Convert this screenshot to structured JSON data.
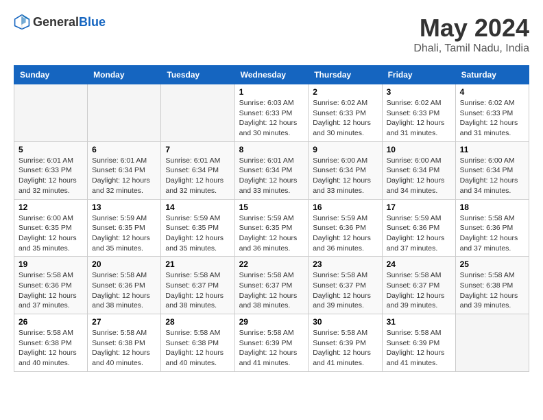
{
  "header": {
    "logo": {
      "general": "General",
      "blue": "Blue"
    },
    "month": "May 2024",
    "location": "Dhali, Tamil Nadu, India"
  },
  "weekdays": [
    "Sunday",
    "Monday",
    "Tuesday",
    "Wednesday",
    "Thursday",
    "Friday",
    "Saturday"
  ],
  "weeks": [
    [
      {
        "day": "",
        "sunrise": "",
        "sunset": "",
        "daylight": ""
      },
      {
        "day": "",
        "sunrise": "",
        "sunset": "",
        "daylight": ""
      },
      {
        "day": "",
        "sunrise": "",
        "sunset": "",
        "daylight": ""
      },
      {
        "day": "1",
        "sunrise": "Sunrise: 6:03 AM",
        "sunset": "Sunset: 6:33 PM",
        "daylight": "Daylight: 12 hours and 30 minutes."
      },
      {
        "day": "2",
        "sunrise": "Sunrise: 6:02 AM",
        "sunset": "Sunset: 6:33 PM",
        "daylight": "Daylight: 12 hours and 30 minutes."
      },
      {
        "day": "3",
        "sunrise": "Sunrise: 6:02 AM",
        "sunset": "Sunset: 6:33 PM",
        "daylight": "Daylight: 12 hours and 31 minutes."
      },
      {
        "day": "4",
        "sunrise": "Sunrise: 6:02 AM",
        "sunset": "Sunset: 6:33 PM",
        "daylight": "Daylight: 12 hours and 31 minutes."
      }
    ],
    [
      {
        "day": "5",
        "sunrise": "Sunrise: 6:01 AM",
        "sunset": "Sunset: 6:33 PM",
        "daylight": "Daylight: 12 hours and 32 minutes."
      },
      {
        "day": "6",
        "sunrise": "Sunrise: 6:01 AM",
        "sunset": "Sunset: 6:34 PM",
        "daylight": "Daylight: 12 hours and 32 minutes."
      },
      {
        "day": "7",
        "sunrise": "Sunrise: 6:01 AM",
        "sunset": "Sunset: 6:34 PM",
        "daylight": "Daylight: 12 hours and 32 minutes."
      },
      {
        "day": "8",
        "sunrise": "Sunrise: 6:01 AM",
        "sunset": "Sunset: 6:34 PM",
        "daylight": "Daylight: 12 hours and 33 minutes."
      },
      {
        "day": "9",
        "sunrise": "Sunrise: 6:00 AM",
        "sunset": "Sunset: 6:34 PM",
        "daylight": "Daylight: 12 hours and 33 minutes."
      },
      {
        "day": "10",
        "sunrise": "Sunrise: 6:00 AM",
        "sunset": "Sunset: 6:34 PM",
        "daylight": "Daylight: 12 hours and 34 minutes."
      },
      {
        "day": "11",
        "sunrise": "Sunrise: 6:00 AM",
        "sunset": "Sunset: 6:34 PM",
        "daylight": "Daylight: 12 hours and 34 minutes."
      }
    ],
    [
      {
        "day": "12",
        "sunrise": "Sunrise: 6:00 AM",
        "sunset": "Sunset: 6:35 PM",
        "daylight": "Daylight: 12 hours and 35 minutes."
      },
      {
        "day": "13",
        "sunrise": "Sunrise: 5:59 AM",
        "sunset": "Sunset: 6:35 PM",
        "daylight": "Daylight: 12 hours and 35 minutes."
      },
      {
        "day": "14",
        "sunrise": "Sunrise: 5:59 AM",
        "sunset": "Sunset: 6:35 PM",
        "daylight": "Daylight: 12 hours and 35 minutes."
      },
      {
        "day": "15",
        "sunrise": "Sunrise: 5:59 AM",
        "sunset": "Sunset: 6:35 PM",
        "daylight": "Daylight: 12 hours and 36 minutes."
      },
      {
        "day": "16",
        "sunrise": "Sunrise: 5:59 AM",
        "sunset": "Sunset: 6:36 PM",
        "daylight": "Daylight: 12 hours and 36 minutes."
      },
      {
        "day": "17",
        "sunrise": "Sunrise: 5:59 AM",
        "sunset": "Sunset: 6:36 PM",
        "daylight": "Daylight: 12 hours and 37 minutes."
      },
      {
        "day": "18",
        "sunrise": "Sunrise: 5:58 AM",
        "sunset": "Sunset: 6:36 PM",
        "daylight": "Daylight: 12 hours and 37 minutes."
      }
    ],
    [
      {
        "day": "19",
        "sunrise": "Sunrise: 5:58 AM",
        "sunset": "Sunset: 6:36 PM",
        "daylight": "Daylight: 12 hours and 37 minutes."
      },
      {
        "day": "20",
        "sunrise": "Sunrise: 5:58 AM",
        "sunset": "Sunset: 6:36 PM",
        "daylight": "Daylight: 12 hours and 38 minutes."
      },
      {
        "day": "21",
        "sunrise": "Sunrise: 5:58 AM",
        "sunset": "Sunset: 6:37 PM",
        "daylight": "Daylight: 12 hours and 38 minutes."
      },
      {
        "day": "22",
        "sunrise": "Sunrise: 5:58 AM",
        "sunset": "Sunset: 6:37 PM",
        "daylight": "Daylight: 12 hours and 38 minutes."
      },
      {
        "day": "23",
        "sunrise": "Sunrise: 5:58 AM",
        "sunset": "Sunset: 6:37 PM",
        "daylight": "Daylight: 12 hours and 39 minutes."
      },
      {
        "day": "24",
        "sunrise": "Sunrise: 5:58 AM",
        "sunset": "Sunset: 6:37 PM",
        "daylight": "Daylight: 12 hours and 39 minutes."
      },
      {
        "day": "25",
        "sunrise": "Sunrise: 5:58 AM",
        "sunset": "Sunset: 6:38 PM",
        "daylight": "Daylight: 12 hours and 39 minutes."
      }
    ],
    [
      {
        "day": "26",
        "sunrise": "Sunrise: 5:58 AM",
        "sunset": "Sunset: 6:38 PM",
        "daylight": "Daylight: 12 hours and 40 minutes."
      },
      {
        "day": "27",
        "sunrise": "Sunrise: 5:58 AM",
        "sunset": "Sunset: 6:38 PM",
        "daylight": "Daylight: 12 hours and 40 minutes."
      },
      {
        "day": "28",
        "sunrise": "Sunrise: 5:58 AM",
        "sunset": "Sunset: 6:38 PM",
        "daylight": "Daylight: 12 hours and 40 minutes."
      },
      {
        "day": "29",
        "sunrise": "Sunrise: 5:58 AM",
        "sunset": "Sunset: 6:39 PM",
        "daylight": "Daylight: 12 hours and 41 minutes."
      },
      {
        "day": "30",
        "sunrise": "Sunrise: 5:58 AM",
        "sunset": "Sunset: 6:39 PM",
        "daylight": "Daylight: 12 hours and 41 minutes."
      },
      {
        "day": "31",
        "sunrise": "Sunrise: 5:58 AM",
        "sunset": "Sunset: 6:39 PM",
        "daylight": "Daylight: 12 hours and 41 minutes."
      },
      {
        "day": "",
        "sunrise": "",
        "sunset": "",
        "daylight": ""
      }
    ]
  ]
}
